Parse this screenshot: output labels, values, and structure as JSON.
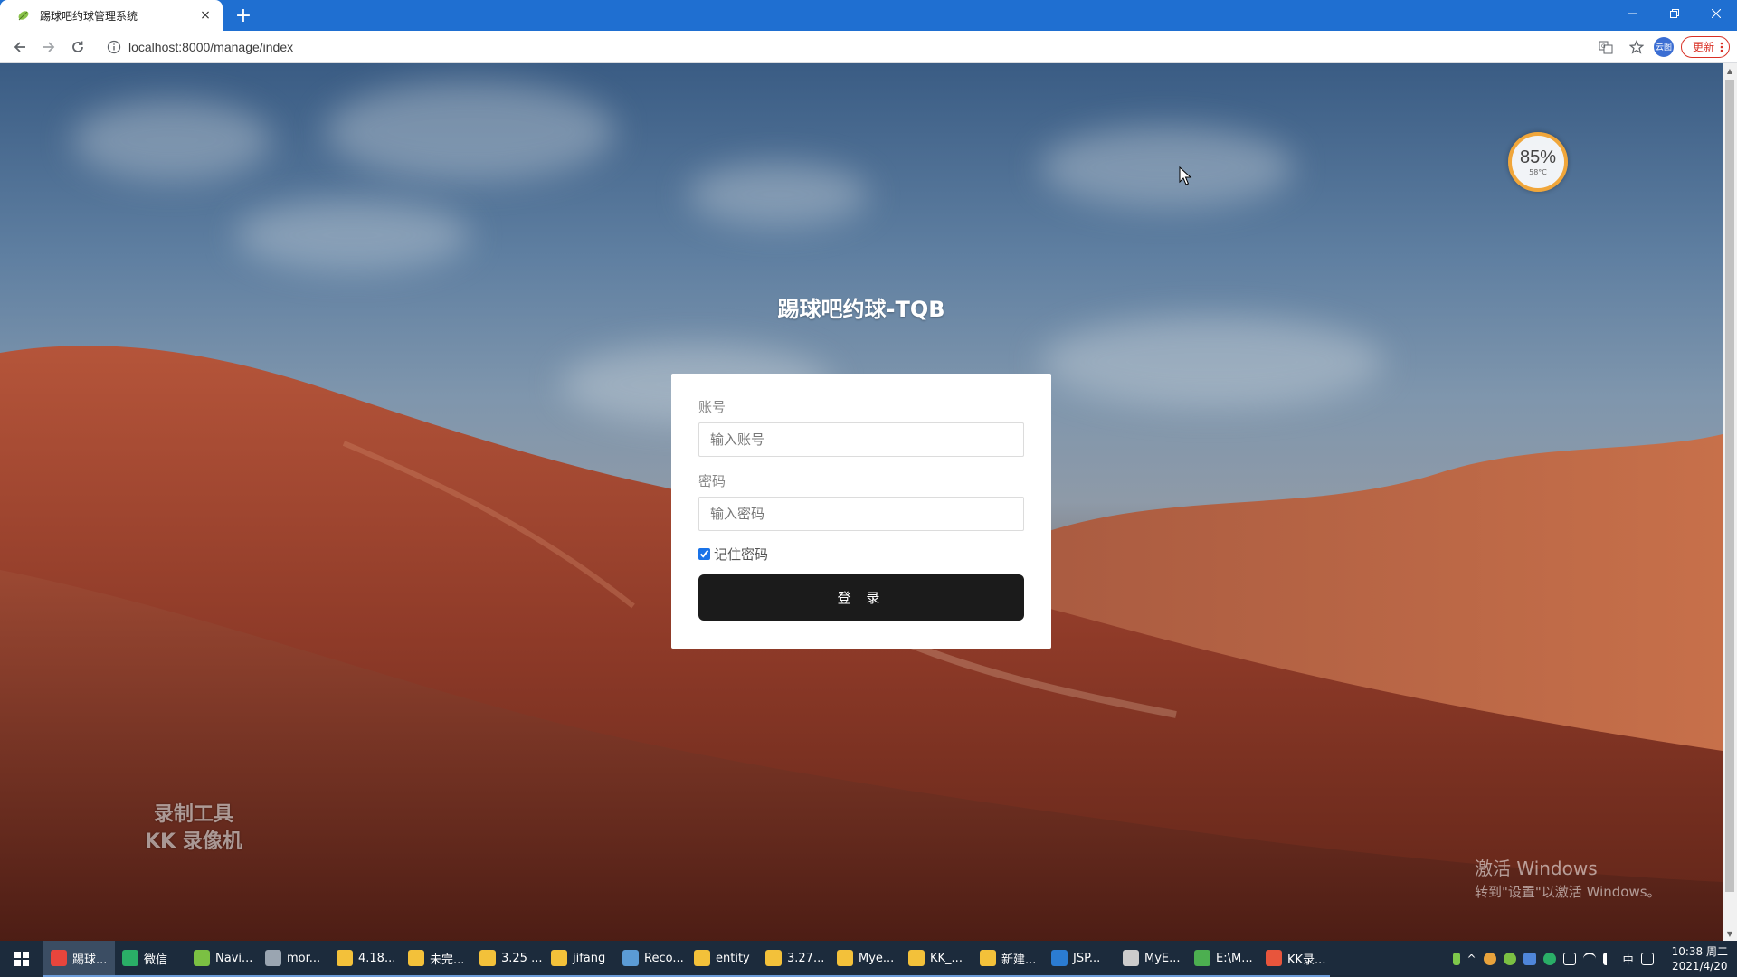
{
  "browser": {
    "tab_title": "踢球吧约球管理系统",
    "close_glyph": "×",
    "new_tab_glyph": "+",
    "url": "localhost:8000/manage/index",
    "update_label": "更新",
    "profile_label": "云图"
  },
  "page": {
    "title": "踢球吧约球-TQB",
    "account_label": "账号",
    "account_placeholder": "输入账号",
    "password_label": "密码",
    "password_placeholder": "输入密码",
    "remember_label": "记住密码",
    "remember_checked": true,
    "login_button": "登 录"
  },
  "overlay": {
    "gauge_percent": "85%",
    "gauge_temp": "58°C",
    "watermark_line1": "录制工具",
    "watermark_line2": "KK 录像机",
    "activate_title": "激活 Windows",
    "activate_sub": "转到\"设置\"以激活 Windows。"
  },
  "taskbar": {
    "items": [
      {
        "label": "踢球...",
        "color": "#e8453c"
      },
      {
        "label": "微信",
        "color": "#2aae67"
      },
      {
        "label": "Navi...",
        "color": "#7bc043"
      },
      {
        "label": "mor...",
        "color": "#9aa5b1"
      },
      {
        "label": "4.18...",
        "color": "#f3c13a"
      },
      {
        "label": "未完...",
        "color": "#f3c13a"
      },
      {
        "label": "3.25 ...",
        "color": "#f3c13a"
      },
      {
        "label": "jifang",
        "color": "#f3c13a"
      },
      {
        "label": "Reco...",
        "color": "#5b9bd5"
      },
      {
        "label": "entity",
        "color": "#f3c13a"
      },
      {
        "label": "3.27...",
        "color": "#f3c13a"
      },
      {
        "label": "Mye...",
        "color": "#f3c13a"
      },
      {
        "label": "KK_...",
        "color": "#f3c13a"
      },
      {
        "label": "新建...",
        "color": "#f3c13a"
      },
      {
        "label": "JSP...",
        "color": "#2b7cd3"
      },
      {
        "label": "MyE...",
        "color": "#cccccc"
      },
      {
        "label": "E:\\M...",
        "color": "#4caf50"
      },
      {
        "label": "KK录...",
        "color": "#e8553c"
      }
    ],
    "ime": "中",
    "time": "10:38 周二",
    "date": "2021/4/20"
  }
}
